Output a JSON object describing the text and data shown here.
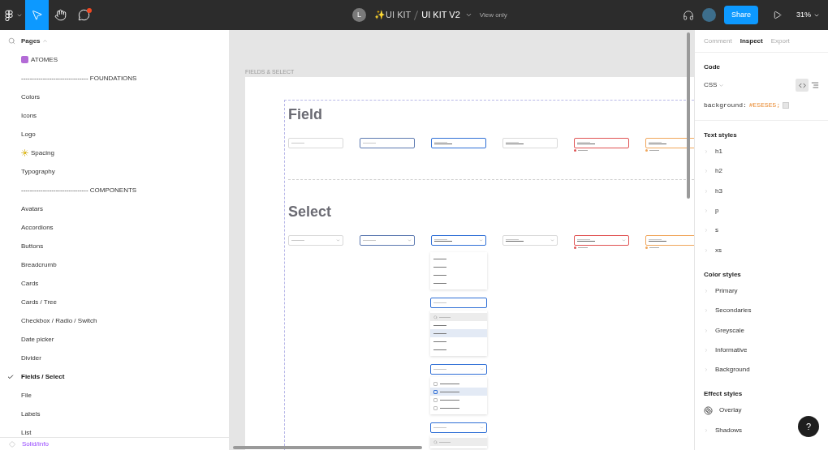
{
  "toolbar": {
    "tools": [
      {
        "kind": "main-menu",
        "selected": false
      },
      {
        "kind": "move",
        "selected": true
      },
      {
        "kind": "hand",
        "selected": false
      },
      {
        "kind": "comment",
        "selected": false,
        "notification": true
      }
    ],
    "avatar_initial": "L",
    "project": "✨UI KIT",
    "file_name": "UI KIT V2",
    "access": "View only",
    "share": "Share",
    "zoom": "31%"
  },
  "pages": {
    "title": "Pages",
    "items": [
      {
        "label": "ATOMES",
        "kind": "badge-page",
        "selected": false
      },
      {
        "label": "------------------------------- FOUNDATIONS",
        "kind": "page",
        "selected": false
      },
      {
        "label": "Colors",
        "kind": "page",
        "selected": false
      },
      {
        "label": "Icons",
        "kind": "page",
        "selected": false
      },
      {
        "label": "Logo",
        "kind": "page",
        "selected": false
      },
      {
        "label": "Spacing",
        "kind": "sun-page",
        "selected": false
      },
      {
        "label": "Typography",
        "kind": "page",
        "selected": false
      },
      {
        "label": "------------------------------- COMPONENTS",
        "kind": "page",
        "selected": false
      },
      {
        "label": "Avatars",
        "kind": "page",
        "selected": false
      },
      {
        "label": "Accordions",
        "kind": "page",
        "selected": false
      },
      {
        "label": "Buttons",
        "kind": "page",
        "selected": false
      },
      {
        "label": "Breadcrumb",
        "kind": "page",
        "selected": false
      },
      {
        "label": "Cards",
        "kind": "page",
        "selected": false
      },
      {
        "label": "Cards / Tree",
        "kind": "page",
        "selected": false
      },
      {
        "label": "Checkbox / Radio / Switch",
        "kind": "page",
        "selected": false
      },
      {
        "label": "Date picker",
        "kind": "page",
        "selected": false
      },
      {
        "label": "Divider",
        "kind": "page",
        "selected": false
      },
      {
        "label": "Fields / Select",
        "kind": "page",
        "selected": true
      },
      {
        "label": "File",
        "kind": "page",
        "selected": false
      },
      {
        "label": "Labels",
        "kind": "page",
        "selected": false
      },
      {
        "label": "List",
        "kind": "page",
        "selected": false
      }
    ],
    "selection": "Solid/info"
  },
  "canvas": {
    "frame_label": "FIELDS & SELECT",
    "sections": [
      {
        "heading": "Field",
        "kind": "field",
        "controls": [
          {
            "kind": "default",
            "filled": false
          },
          {
            "kind": "hover",
            "filled": false
          },
          {
            "kind": "focus",
            "filled": true
          },
          {
            "kind": "default",
            "filled": true
          },
          {
            "kind": "error",
            "filled": true
          },
          {
            "kind": "warning",
            "filled": true
          }
        ]
      },
      {
        "heading": "Select",
        "kind": "select",
        "controls": [
          {
            "kind": "default",
            "filled": false
          },
          {
            "kind": "hover",
            "filled": false
          },
          {
            "kind": "focus",
            "filled": true
          },
          {
            "kind": "default",
            "filled": true
          },
          {
            "kind": "error",
            "filled": true
          },
          {
            "kind": "warning",
            "filled": true
          }
        ],
        "menus": [
          {
            "kind": "list",
            "items": [
              {
                "selected": false
              },
              {
                "selected": false
              },
              {
                "selected": false
              },
              {
                "selected": false
              }
            ]
          },
          {
            "kind": "search-list",
            "items": [
              {
                "selected": false
              },
              {
                "selected": true
              },
              {
                "selected": false
              },
              {
                "selected": false
              }
            ]
          },
          {
            "kind": "checkbox-list",
            "items": [
              {
                "selected": false
              },
              {
                "selected": true
              },
              {
                "selected": false
              },
              {
                "selected": false
              }
            ]
          },
          {
            "kind": "search-checkbox-list"
          }
        ]
      }
    ]
  },
  "inspect": {
    "tabs": [
      {
        "label": "Comment",
        "selected": false
      },
      {
        "label": "Inspect",
        "selected": true
      },
      {
        "label": "Export",
        "selected": false
      }
    ],
    "code_title": "Code",
    "language": "CSS",
    "code_property": "background:",
    "code_value": "#E5E5E5;",
    "groups": [
      {
        "title": "Text styles",
        "items": [
          {
            "label": "h1",
            "kind": "style"
          },
          {
            "label": "h2",
            "kind": "style"
          },
          {
            "label": "h3",
            "kind": "style"
          },
          {
            "label": "p",
            "kind": "style"
          },
          {
            "label": "s",
            "kind": "style"
          },
          {
            "label": "xs",
            "kind": "style"
          }
        ]
      },
      {
        "title": "Color styles",
        "items": [
          {
            "label": "Primary",
            "kind": "style"
          },
          {
            "label": "Secondaries",
            "kind": "style"
          },
          {
            "label": "Greyscale",
            "kind": "style"
          },
          {
            "label": "Informative",
            "kind": "style"
          },
          {
            "label": "Background",
            "kind": "style"
          }
        ]
      },
      {
        "title": "Effect styles",
        "items": [
          {
            "label": "Overlay",
            "kind": "effect"
          },
          {
            "label": "Shadows",
            "kind": "style"
          }
        ]
      }
    ],
    "help": "?"
  }
}
